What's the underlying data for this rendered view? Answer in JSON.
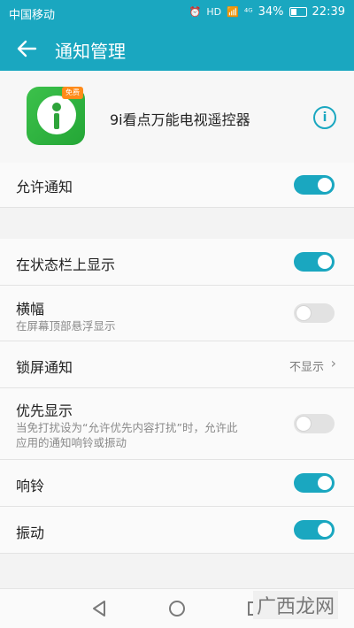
{
  "statusbar": {
    "carrier": "中国移动",
    "hd": "HD",
    "signal": "⁴ᴳ",
    "battery": "34%",
    "time": "22:39"
  },
  "appbar": {
    "title": "通知管理"
  },
  "app": {
    "name": "9i看点万能电视遥控器",
    "icon_tag": "免费",
    "info_icon": "i"
  },
  "settings": {
    "allow_notifications": {
      "label": "允许通知",
      "on": true
    },
    "status_bar": {
      "label": "在状态栏上显示",
      "on": true
    },
    "banner": {
      "label": "横幅",
      "sub": "在屏幕顶部悬浮显示",
      "on": false
    },
    "lock_screen": {
      "label": "锁屏通知",
      "value": "不显示"
    },
    "priority": {
      "label": "优先显示",
      "sub1": "当免打扰设为“允许优先内容打扰”时，允许此",
      "sub2": "应用的通知响铃或振动",
      "on": false
    },
    "ring": {
      "label": "响铃",
      "on": true
    },
    "vibrate": {
      "label": "振动",
      "on": true
    }
  },
  "watermark": "广西龙网",
  "colors": {
    "accent": "#1aa7c0",
    "toggle_off": "#e2e2e2"
  }
}
